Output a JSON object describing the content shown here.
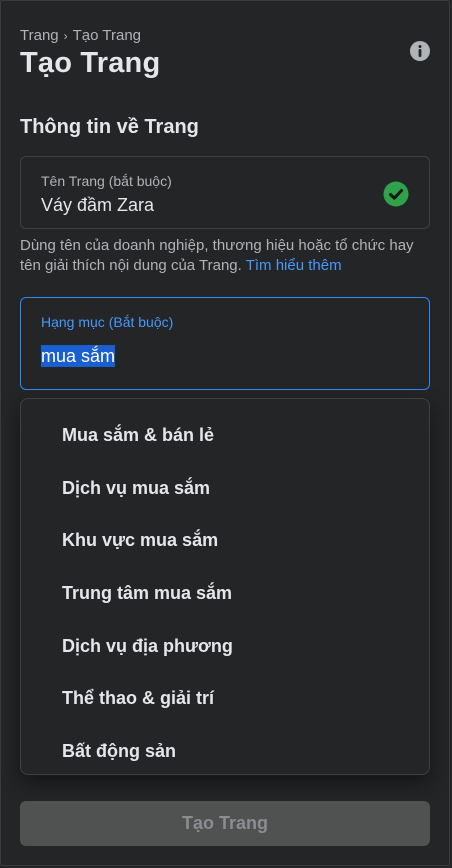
{
  "breadcrumb": {
    "parent": "Trang",
    "separator": "›",
    "current": "Tạo Trang"
  },
  "page_title": "Tạo Trang",
  "section_title": "Thông tin về Trang",
  "name_field": {
    "label": "Tên Trang (bắt buộc)",
    "value": "Váy đầm Zara",
    "status": "valid"
  },
  "help": {
    "text": "Dùng tên của doanh nghiệp, thương hiệu hoặc tổ chức hay tên giải thích nội dung của Trang. ",
    "link": "Tìm hiểu thêm"
  },
  "category_field": {
    "label": "Hạng mục (Bắt buộc)",
    "value": "mua sắm"
  },
  "dropdown": {
    "options": [
      "Mua sắm & bán lẻ",
      "Dịch vụ mua sắm",
      "Khu vực mua sắm",
      "Trung tâm mua sắm",
      "Dịch vụ địa phương",
      "Thể thao & giải trí",
      "Bất động sản"
    ]
  },
  "submit_label": "Tạo Trang",
  "colors": {
    "background": "#242526",
    "accent": "#2d88ff",
    "success": "#31a24c",
    "disabled_button": "#505151"
  },
  "icons": {
    "info": "info-icon",
    "check": "check-circle-icon",
    "chevron": "chevron-right-icon"
  }
}
